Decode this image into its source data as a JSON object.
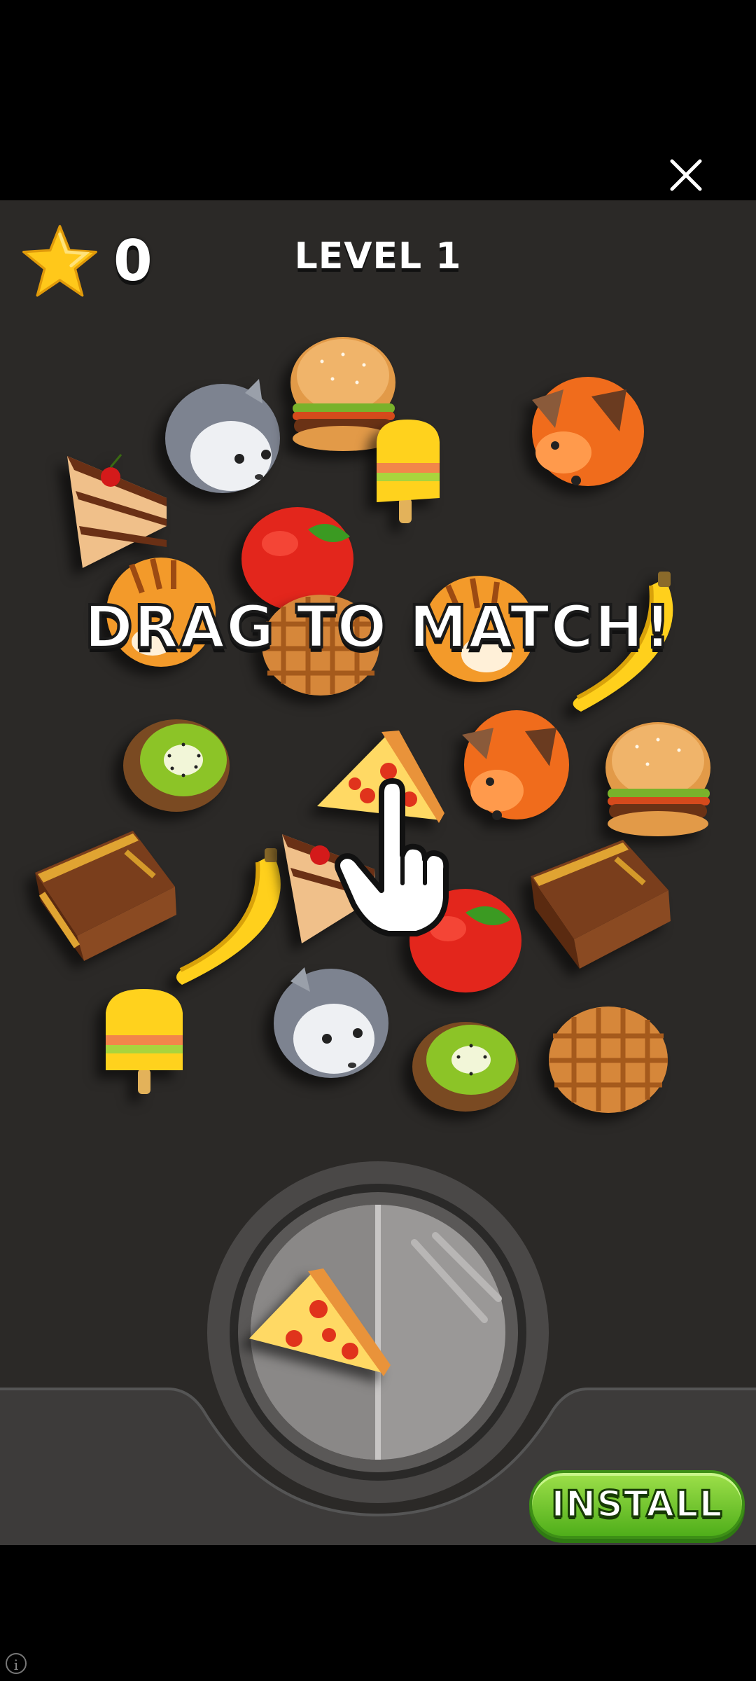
{
  "hud": {
    "score": "0",
    "level": "LEVEL 1"
  },
  "hint": {
    "text": "DRAG TO MATCH!"
  },
  "cta": {
    "install_label": "INSTALL"
  },
  "tray": {
    "held_item": "pizza-slice"
  },
  "info": {
    "glyph": "i"
  },
  "colors": {
    "background": "#2b2927",
    "install_green": "#5fbe22",
    "star": "#ffc81a"
  },
  "board_items": [
    "hamster",
    "burger",
    "popsicle",
    "fox",
    "cake-slice",
    "apple",
    "cat",
    "waffle",
    "banana",
    "kiwi",
    "pizza-slice",
    "treasure-chest"
  ]
}
